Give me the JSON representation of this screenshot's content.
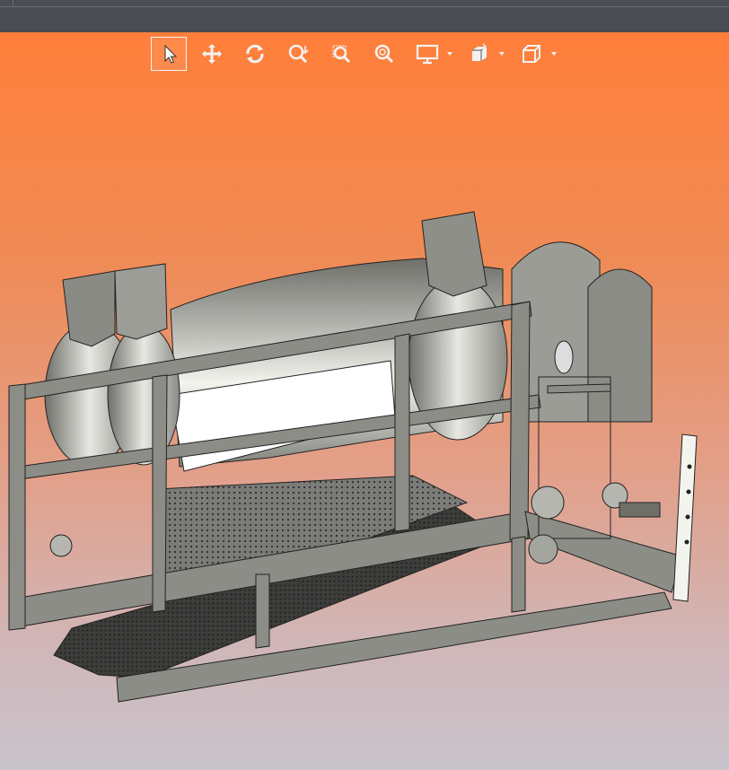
{
  "window": {
    "title": ""
  },
  "toolbar": {
    "tools": [
      {
        "id": "select",
        "icon": "select-arrow-icon",
        "active": true
      },
      {
        "id": "pan",
        "icon": "pan-move-icon",
        "active": false
      },
      {
        "id": "rotate",
        "icon": "rotate-icon",
        "active": false
      },
      {
        "id": "zoom-dynamic",
        "icon": "zoom-dynamic-icon",
        "active": false
      },
      {
        "id": "zoom-window",
        "icon": "zoom-window-icon",
        "active": false
      },
      {
        "id": "zoom-fit",
        "icon": "zoom-fit-icon",
        "active": false
      },
      {
        "id": "display-style",
        "icon": "display-monitor-icon",
        "dropdown": true
      },
      {
        "id": "view-orientation",
        "icon": "view-cube-stack-icon",
        "dropdown": true
      },
      {
        "id": "standard-views",
        "icon": "iso-cube-icon",
        "dropdown": true
      }
    ]
  },
  "colors": {
    "bg_top": "#ff7f3a",
    "bg_bottom": "#c9c4cc",
    "frame": "#8c8d86",
    "drum": "#a8a9a2",
    "toolbar_icon": "#f2f2f2"
  },
  "viewport": {
    "model": "drum-sieve-assembly"
  }
}
